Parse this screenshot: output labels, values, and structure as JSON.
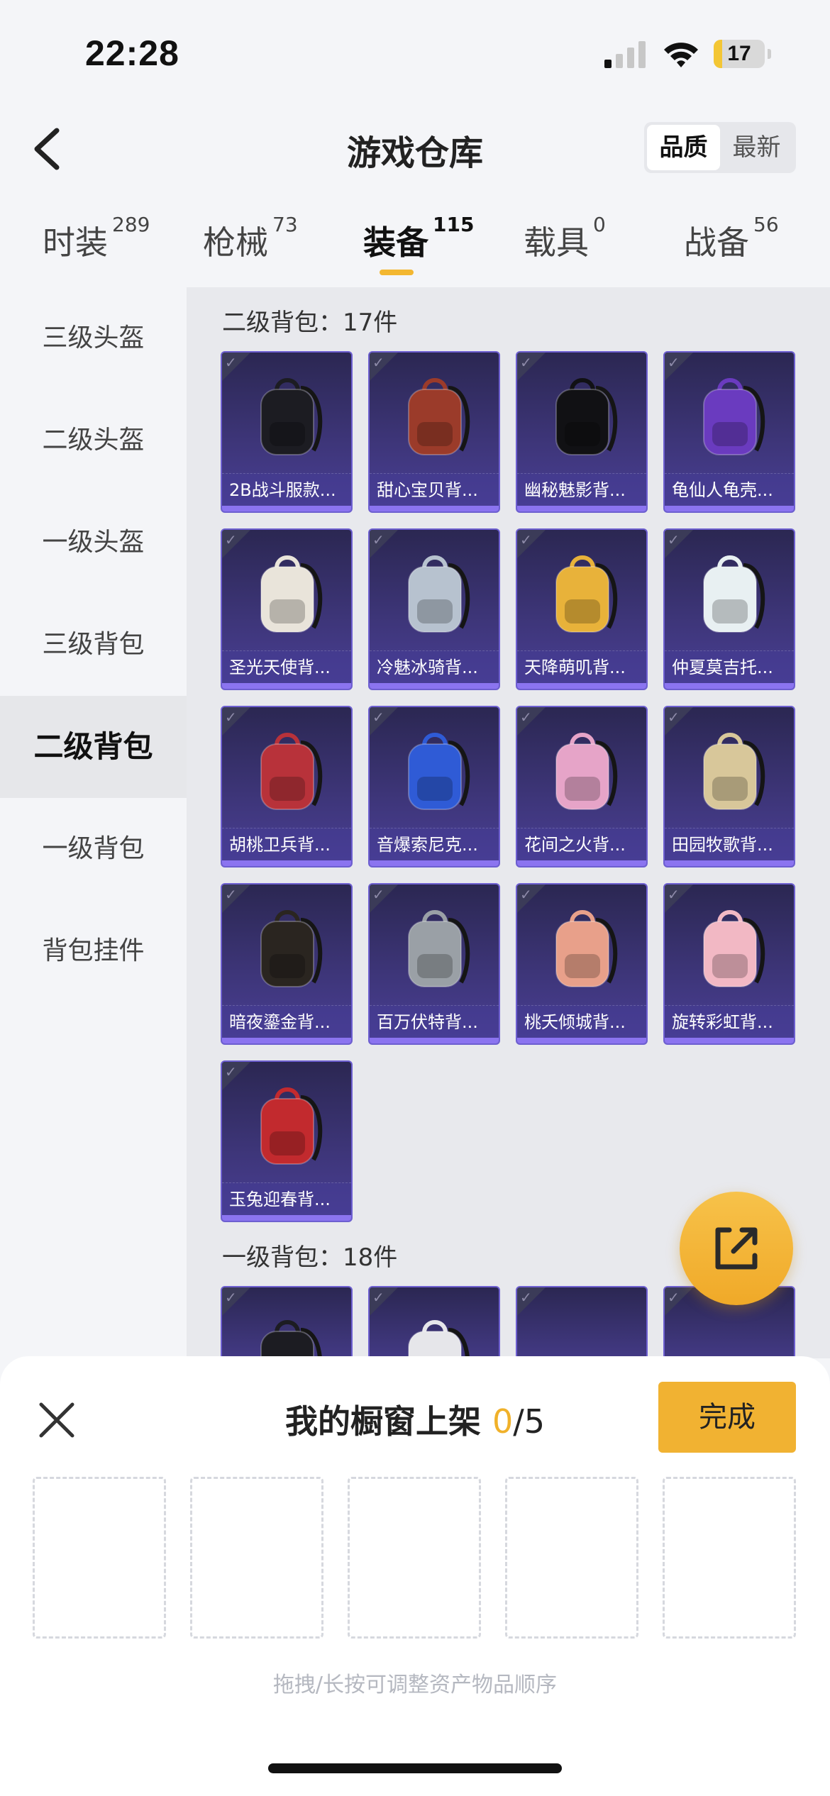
{
  "status_bar": {
    "time": "22:28",
    "battery": "17",
    "battery_level": 0.17
  },
  "header": {
    "title": "游戏仓库",
    "sort_options": [
      "品质",
      "最新"
    ],
    "active_sort": "品质"
  },
  "tabs": [
    {
      "label": "时装",
      "count": "289"
    },
    {
      "label": "枪械",
      "count": "73"
    },
    {
      "label": "装备",
      "count": "115"
    },
    {
      "label": "载具",
      "count": "0"
    },
    {
      "label": "战备",
      "count": "56"
    }
  ],
  "active_tab": "装备",
  "sidebar": {
    "items": [
      "三级头盔",
      "二级头盔",
      "一级头盔",
      "三级背包",
      "二级背包",
      "一级背包",
      "背包挂件"
    ],
    "active": "二级背包"
  },
  "sections": [
    {
      "title": "二级背包：17件",
      "items": [
        {
          "name": "2B战斗服款...",
          "color": "#1c1c22"
        },
        {
          "name": "甜心宝贝背...",
          "color": "#9b3b2a"
        },
        {
          "name": "幽秘魅影背...",
          "color": "#111114"
        },
        {
          "name": "龟仙人龟壳...",
          "color": "#6a3bbf"
        },
        {
          "name": "圣光天使背...",
          "color": "#e9e4da"
        },
        {
          "name": "冷魅冰骑背...",
          "color": "#b7c2cf"
        },
        {
          "name": "天降萌叽背...",
          "color": "#e8b23a"
        },
        {
          "name": "仲夏莫吉托...",
          "color": "#e8f0f2"
        },
        {
          "name": "胡桃卫兵背...",
          "color": "#b8323a"
        },
        {
          "name": "音爆索尼克...",
          "color": "#2f5bd6"
        },
        {
          "name": "花间之火背...",
          "color": "#e6a4c8"
        },
        {
          "name": "田园牧歌背...",
          "color": "#d8c79a"
        },
        {
          "name": "暗夜鎏金背...",
          "color": "#2a2520"
        },
        {
          "name": "百万伏特背...",
          "color": "#9aa0a6"
        },
        {
          "name": "桃夭倾城背...",
          "color": "#e8a08a"
        },
        {
          "name": "旋转彩虹背...",
          "color": "#f2b8c4"
        },
        {
          "name": "玉兔迎春背...",
          "color": "#c22a2e"
        }
      ]
    },
    {
      "title": "一级背包：18件",
      "items": [
        {
          "name": "",
          "color": "#1c1c22"
        },
        {
          "name": "",
          "color": "#e6e6ea"
        },
        {
          "name": "",
          "color": "#3a3468"
        },
        {
          "name": "",
          "color": "#3a3468"
        }
      ]
    }
  ],
  "panel": {
    "title": "我的橱窗上架",
    "count": "0",
    "total": "/5",
    "done_label": "完成",
    "slots": 5,
    "hint": "拖拽/长按可调整资产物品顺序"
  }
}
